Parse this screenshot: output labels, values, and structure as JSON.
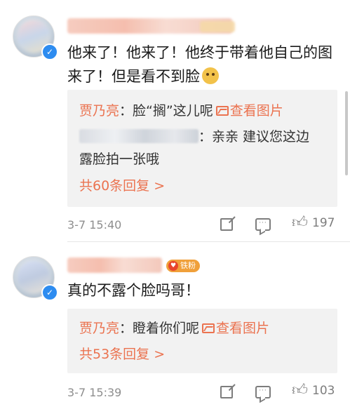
{
  "comments": [
    {
      "text": "他来了！他来了！他终于带着他自己的图来了！但是看不到脸",
      "emoji": "doge-emoji",
      "replies": [
        {
          "author": "贾乃亮",
          "text": "：脸“搁”这儿呢",
          "link": "查看图片"
        },
        {
          "author": "",
          "text": "：亲亲 建议您这边",
          "text2": "露脸拍一张哦"
        }
      ],
      "more_replies": "共60条回复 >",
      "time": "3-7 15:40",
      "likes": "197"
    },
    {
      "text": "真的不露个脸吗哥！",
      "badge": "铁粉",
      "replies": [
        {
          "author": "贾乃亮",
          "text": "：瞪着你们呢",
          "link": "查看图片"
        }
      ],
      "more_replies": "共53条回复 >",
      "time": "3-7 15:39",
      "likes": "103"
    }
  ],
  "colors": {
    "accent": "#eb7350",
    "verified": "#2d8cf0",
    "badge": "#f0a03a"
  }
}
